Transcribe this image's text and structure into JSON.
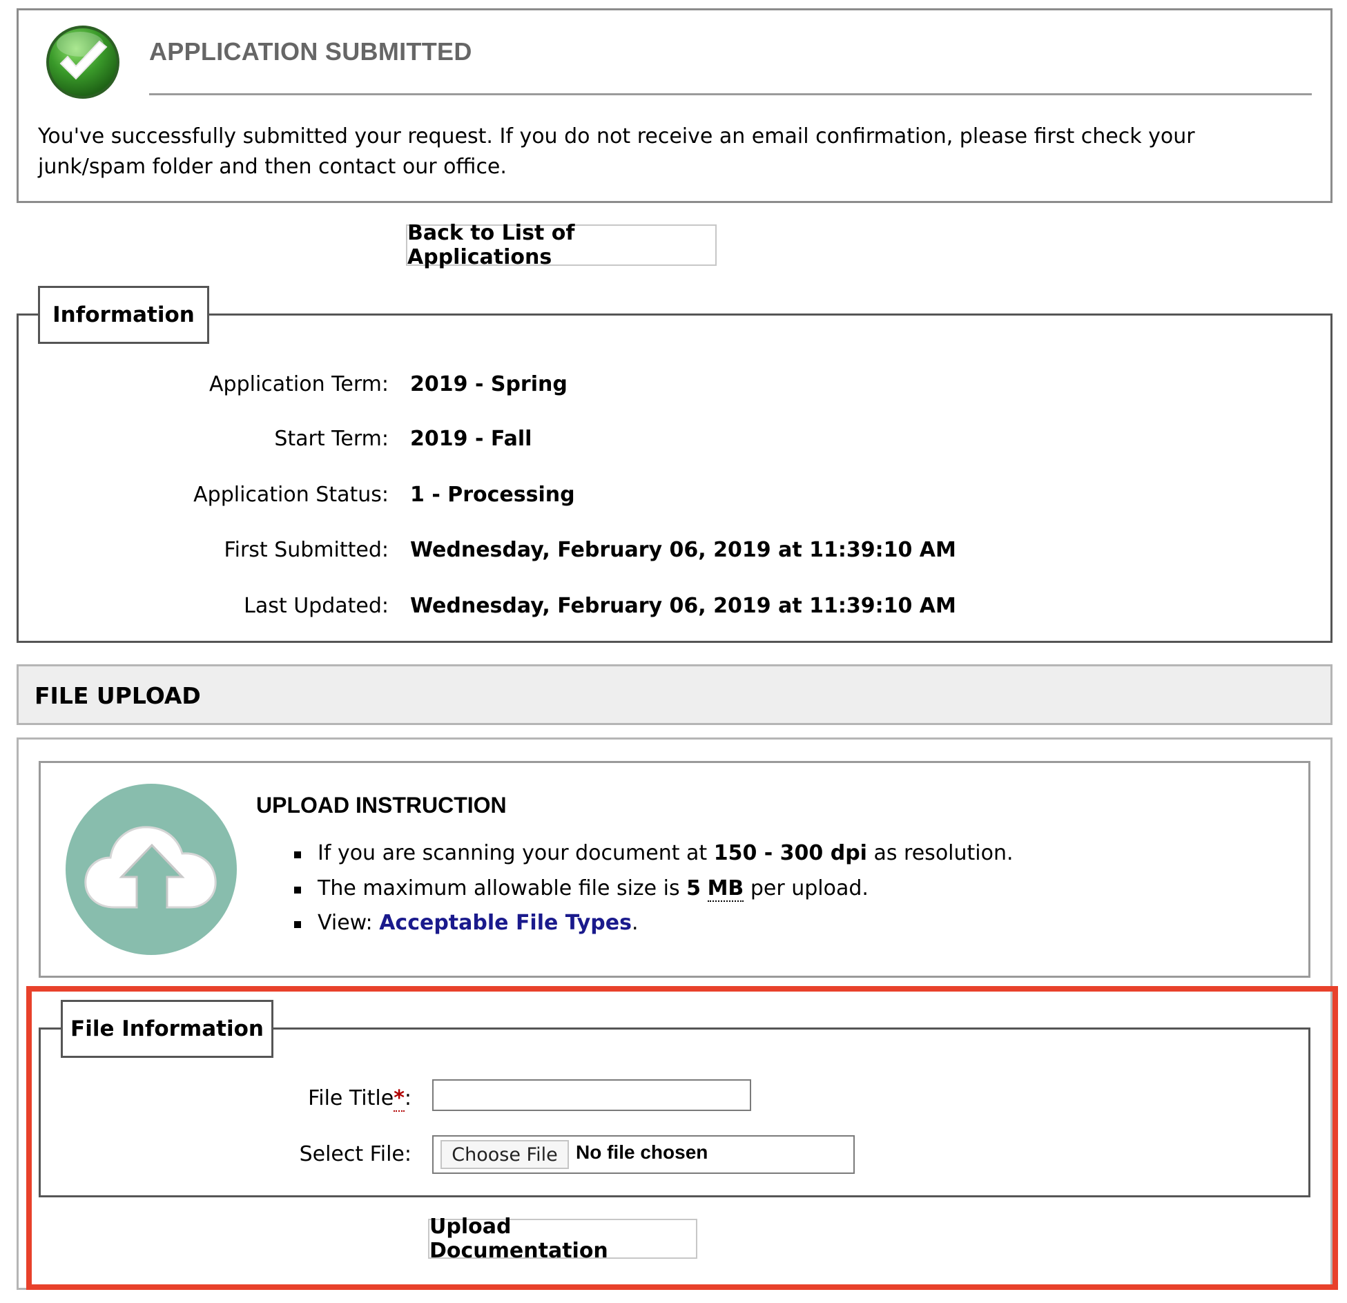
{
  "success": {
    "title": "APPLICATION SUBMITTED",
    "message": "You've successfully submitted your request. If you do not receive an email confirmation, please first check your junk/spam folder and then contact our office.",
    "icon": "check-circle-icon",
    "icon_color": "#3a9a2a"
  },
  "back_button": "Back to List of Applications",
  "information": {
    "legend": "Information",
    "rows": [
      {
        "label": "Application Term:",
        "value": "2019 - Spring"
      },
      {
        "label": "Start Term:",
        "value": "2019 - Fall"
      },
      {
        "label": "Application Status:",
        "value": "1 - Processing"
      },
      {
        "label": "First Submitted:",
        "value": "Wednesday, February 06, 2019 at 11:39:10 AM"
      },
      {
        "label": "Last Updated:",
        "value": "Wednesday, February 06, 2019 at 11:39:10 AM"
      }
    ]
  },
  "file_upload": {
    "header": "FILE UPLOAD",
    "instruction_title": "UPLOAD INSTRUCTION",
    "upload_icon": "cloud-upload-icon",
    "upload_icon_color": "#88bdad",
    "items": {
      "scan_pre": "If you are scanning your document at ",
      "scan_bold": "150 - 300 dpi",
      "scan_post": " as resolution.",
      "size_pre": "The maximum allowable file size is ",
      "size_num": "5",
      "size_unit": "MB",
      "size_post": " per upload.",
      "view_pre": "View: ",
      "view_link": "Acceptable File Types",
      "view_post": "."
    }
  },
  "file_information": {
    "legend": "File Information",
    "title_label": "File Title",
    "required_mark": "*",
    "label_colon": ":",
    "title_value": "",
    "select_label": "Select File:",
    "choose_button": "Choose File",
    "no_file": "No file chosen"
  },
  "upload_button": "Upload Documentation",
  "highlight_color": "#e8412b"
}
